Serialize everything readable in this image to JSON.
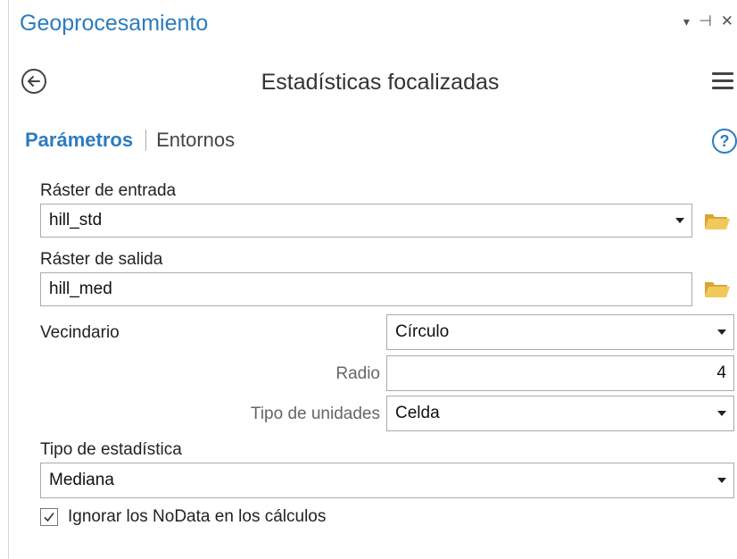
{
  "pane": {
    "title": "Geoprocesamiento",
    "controls": {
      "dropdown_icon": "▾",
      "pin_icon": "⊣",
      "close_icon": "✕"
    }
  },
  "tool": {
    "title": "Estadísticas focalizadas",
    "back_icon": "back-arrow-icon",
    "menu_icon": "hamburger-menu-icon"
  },
  "tabs": {
    "items": [
      {
        "label": "Parámetros",
        "active": true
      },
      {
        "label": "Entornos",
        "active": false
      }
    ],
    "help_glyph": "?"
  },
  "params": {
    "input_raster": {
      "label": "Ráster de entrada",
      "value": "hill_std"
    },
    "output_raster": {
      "label": "Ráster de salida",
      "value": "hill_med"
    },
    "neighborhood": {
      "label": "Vecindario",
      "value": "Círculo"
    },
    "radius": {
      "label": "Radio",
      "value": "4"
    },
    "units_type": {
      "label": "Tipo de unidades",
      "value": "Celda"
    },
    "statistic_type": {
      "label": "Tipo de estadística",
      "value": "Mediana"
    },
    "ignore_nodata": {
      "label": "Ignorar los NoData en los cálculos",
      "checked": true,
      "check_glyph": "✓"
    }
  },
  "colors": {
    "accent": "#2c7cbf",
    "folder": "#e6b94a"
  }
}
